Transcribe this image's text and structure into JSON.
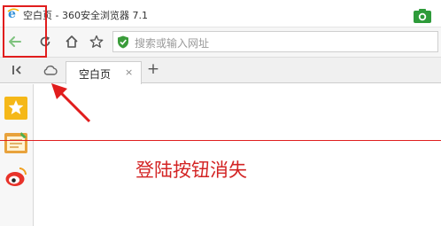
{
  "window": {
    "title": "空白页 - 360安全浏览器 7.1"
  },
  "address_bar": {
    "placeholder": "搜索或输入网址"
  },
  "tabs": [
    {
      "label": "空白页",
      "close": "×"
    }
  ],
  "new_tab_label": "+",
  "annotation": {
    "caption": "登陆按钮消失"
  },
  "colors": {
    "browser_logo": "#2f8fd8",
    "camera_icon": "#2e9b3a",
    "shield_icon": "#3a9c3a",
    "annotation_red": "#e11d1d",
    "caption_red": "#d32424",
    "favorites_star": "#f5b818",
    "weibo_red": "#e8332a"
  },
  "icons": {
    "browser_logo": "ie-e-logo-icon",
    "camera": "camera-icon",
    "back": "back-arrow-icon",
    "refresh": "refresh-icon",
    "home": "home-icon",
    "favorite": "star-icon",
    "shield": "shield-icon",
    "sidebar_toggle": "sidebar-toggle-icon",
    "cloud": "cloud-icon",
    "favorites_side": "favorites-star-icon",
    "notes_side": "notes-icon",
    "weibo_side": "weibo-icon"
  }
}
